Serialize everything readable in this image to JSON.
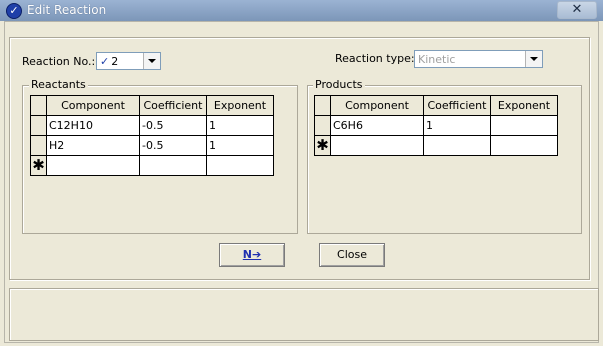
{
  "window": {
    "title": "Edit Reaction",
    "close_glyph": "✕"
  },
  "form": {
    "reaction_no_label": "Reaction No.:",
    "reaction_no_value": "2",
    "reaction_type_label": "Reaction type:",
    "reaction_type_value": "Kinetic"
  },
  "reactants": {
    "title": "Reactants",
    "columns": [
      "Component",
      "Coefficient",
      "Exponent"
    ],
    "rows": [
      [
        "C12H10",
        "-0.5",
        "1"
      ],
      [
        "H2",
        "-0.5",
        "1"
      ]
    ],
    "new_row_marker": "✱"
  },
  "products": {
    "title": "Products",
    "columns": [
      "Component",
      "Coefficient",
      "Exponent"
    ],
    "rows": [
      [
        "C6H6",
        "1",
        ""
      ]
    ],
    "new_row_marker": "✱"
  },
  "buttons": {
    "next_label": "N➔",
    "close_label": "Close"
  },
  "colors": {
    "accent": "#1f3fa8",
    "titlebar": "#8aa3c6",
    "dialog_bg": "#ece9d8"
  },
  "icons": [
    "app-icon",
    "checkmark-icon",
    "chevron-down-icon",
    "close-icon",
    "new-row-icon"
  ]
}
